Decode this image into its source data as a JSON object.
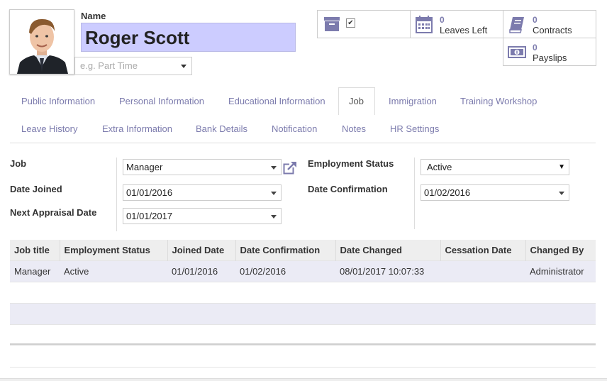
{
  "header": {
    "name_label": "Name",
    "employee_name": "Roger Scott",
    "tag_placeholder": "e.g. Part Time"
  },
  "smart_buttons": {
    "archive_checked": "✔",
    "leaves": {
      "count": "0",
      "label": "Leaves Left"
    },
    "contracts": {
      "count": "0",
      "label": "Contracts"
    },
    "payslips": {
      "count": "0",
      "label": "Payslips"
    }
  },
  "tabs_row1": [
    {
      "label": "Public Information"
    },
    {
      "label": "Personal Information"
    },
    {
      "label": "Educational Information"
    },
    {
      "label": "Job"
    },
    {
      "label": "Immigration"
    },
    {
      "label": "Training Workshop"
    }
  ],
  "tabs_row2": [
    {
      "label": "Leave History"
    },
    {
      "label": "Extra Information"
    },
    {
      "label": "Bank Details"
    },
    {
      "label": "Notification"
    },
    {
      "label": "Notes"
    },
    {
      "label": "HR Settings"
    }
  ],
  "active_tab": "Job",
  "form": {
    "job": {
      "label": "Job",
      "value": "Manager"
    },
    "date_joined": {
      "label": "Date Joined",
      "value": "01/01/2016"
    },
    "next_appraisal": {
      "label": "Next Appraisal Date",
      "value": "01/01/2017"
    },
    "employment_status": {
      "label": "Employment Status",
      "value": "Active"
    },
    "date_confirmation": {
      "label": "Date Confirmation",
      "value": "01/02/2016"
    }
  },
  "history_table": {
    "columns": [
      "Job title",
      "Employment Status",
      "Joined Date",
      "Date Confirmation",
      "Date Changed",
      "Cessation Date",
      "Changed By"
    ],
    "rows": [
      [
        "Manager",
        "Active",
        "01/01/2016",
        "01/02/2016",
        "08/01/2017 10:07:33",
        "",
        "Administrator"
      ]
    ]
  },
  "colors": {
    "accent": "#7c7bad",
    "name_background": "#ccccff",
    "row_stripe": "#ebebf5"
  }
}
